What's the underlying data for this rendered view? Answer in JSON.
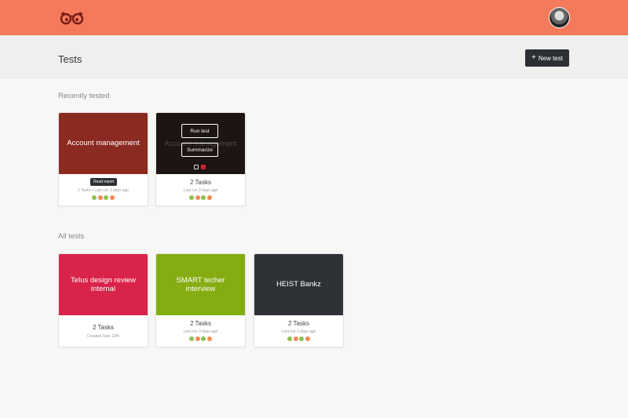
{
  "header": {
    "title": "Tests",
    "new_test_label": "New test"
  },
  "sections": {
    "recent": "Recently tested",
    "all": "All tests"
  },
  "recent_cards": [
    {
      "title": "Account management",
      "tasks": "2 Tasks",
      "meta": "2 Tasks  •  Last run 3 days ago",
      "tooltip": "Read report",
      "color": "#8b2a21",
      "dots": [
        "#8cc152",
        "#f08c5a",
        "#8cc152",
        "#f08c5a"
      ]
    },
    {
      "title": "Account management",
      "tasks": "2 Tasks",
      "meta": "Last run 3 days ago",
      "color": "#1d1414",
      "actions": {
        "run": "Run test",
        "summarize": "Summarize"
      },
      "dots": [
        "#8cc152",
        "#f08c5a",
        "#8cc152",
        "#f08c5a"
      ]
    }
  ],
  "all_cards": [
    {
      "title": "Telus design review internal",
      "tasks": "2 Tasks",
      "meta": "Created June 12th",
      "color": "#d9234a",
      "dots": []
    },
    {
      "title": "SMART techer interview",
      "tasks": "2 Tasks",
      "meta": "Last run 3 days ago",
      "color": "#84ad12",
      "dots": [
        "#8cc152",
        "#f08c5a",
        "#8cc152",
        "#f08c5a"
      ]
    },
    {
      "title": "HEIST Bankz",
      "tasks": "2 Tasks",
      "meta": "Last run 3 days ago",
      "color": "#2e3136",
      "dots": [
        "#8cc152",
        "#f08c5a",
        "#8cc152",
        "#f08c5a"
      ]
    }
  ]
}
